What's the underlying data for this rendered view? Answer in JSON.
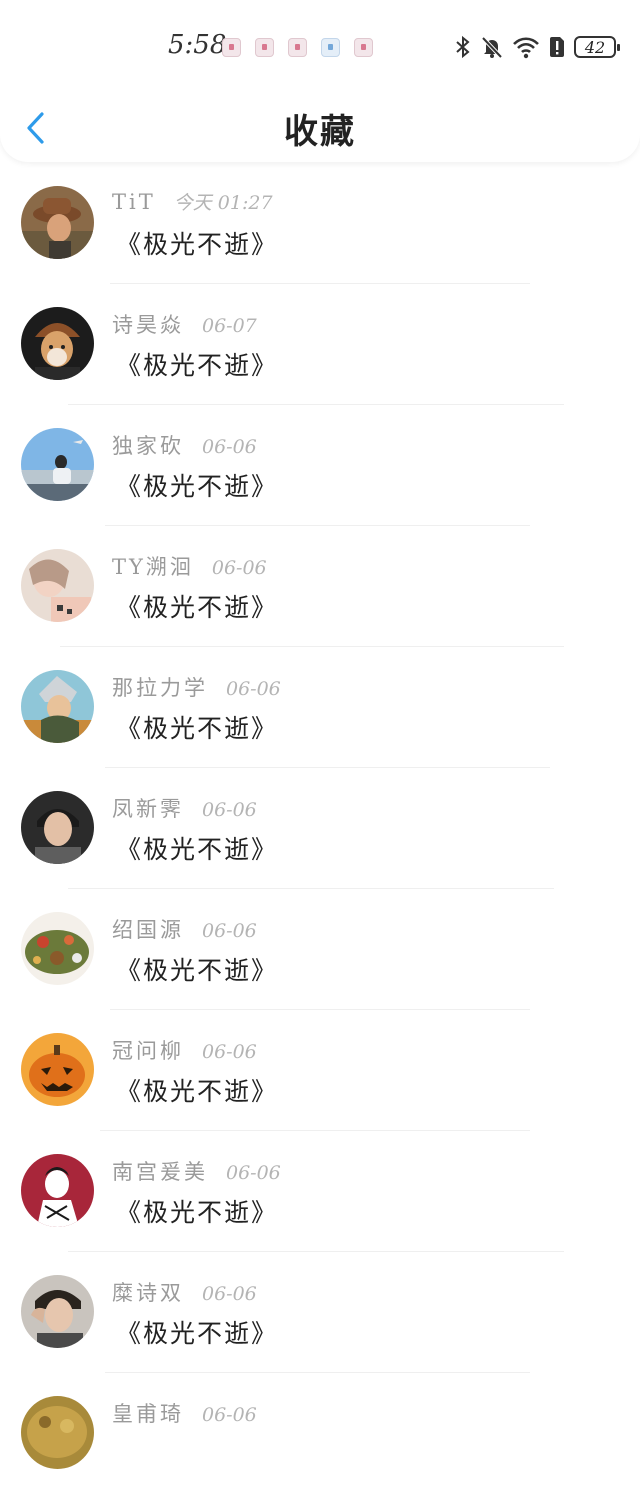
{
  "status_bar": {
    "time": "5:58",
    "battery": "42",
    "notification_icons": [
      "app-notification-icon",
      "app-notification-icon",
      "app-notification-icon",
      "app-notification-icon",
      "app-notification-icon"
    ],
    "system_icons": [
      "bluetooth-icon",
      "mute-icon",
      "wifi-icon",
      "sim-alert-icon",
      "battery-icon"
    ]
  },
  "nav": {
    "title": "收藏",
    "back_icon": "chevron-left-icon"
  },
  "colors": {
    "accent": "#2e9bea",
    "name_text": "#9a9a9a",
    "time_text": "#b4b4b4",
    "title_text": "#222222"
  },
  "favorites": [
    {
      "name": "TiT",
      "time": "今天 01:27",
      "work": "《极光不逝》"
    },
    {
      "name": "诗昊焱",
      "time": "06-07",
      "work": "《极光不逝》"
    },
    {
      "name": "独家砍",
      "time": "06-06",
      "work": "《极光不逝》"
    },
    {
      "name": "TY溯洄",
      "time": "06-06",
      "work": "《极光不逝》"
    },
    {
      "name": "那拉力学",
      "time": "06-06",
      "work": "《极光不逝》"
    },
    {
      "name": "凤新霁",
      "time": "06-06",
      "work": "《极光不逝》"
    },
    {
      "name": "绍国源",
      "time": "06-06",
      "work": "《极光不逝》"
    },
    {
      "name": "冠问柳",
      "time": "06-06",
      "work": "《极光不逝》"
    },
    {
      "name": "南宫爰美",
      "time": "06-06",
      "work": "《极光不逝》"
    },
    {
      "name": "糜诗双",
      "time": "06-06",
      "work": "《极光不逝》"
    },
    {
      "name": "皇甫琦",
      "time": "06-06",
      "work": ""
    }
  ]
}
